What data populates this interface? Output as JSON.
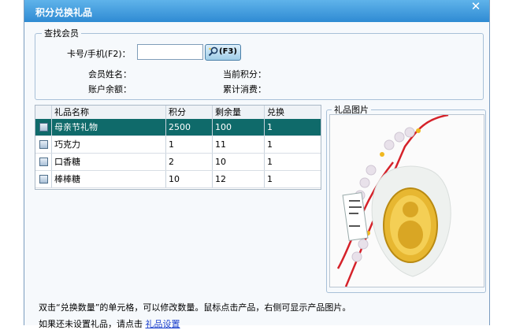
{
  "window": {
    "title": "积分兑换礼品",
    "close_icon": "close-icon"
  },
  "member_search": {
    "legend": "查找会员",
    "card_label": "卡号/手机(F2)：",
    "card_value": "",
    "search_button": "(F3)",
    "name_label": "会员姓名：",
    "points_label": "当前积分：",
    "balance_label": "账户余额：",
    "total_spend_label": "累计消费："
  },
  "gift_table": {
    "columns": [
      "礼品名称",
      "积分",
      "剩余量",
      "兑换"
    ],
    "rows": [
      {
        "name": "母亲节礼物",
        "points": "2500",
        "remaining": "100",
        "exchange": "1",
        "selected": true
      },
      {
        "name": "巧克力",
        "points": "1",
        "remaining": "11",
        "exchange": "1",
        "selected": false
      },
      {
        "name": "口香糖",
        "points": "2",
        "remaining": "10",
        "exchange": "1",
        "selected": false
      },
      {
        "name": "棒棒糖",
        "points": "10",
        "remaining": "12",
        "exchange": "1",
        "selected": false
      }
    ]
  },
  "gift_image": {
    "legend": "礼品图片"
  },
  "footer": {
    "hint": "双击“兑换数量”的单元格，可以修改数量。鼠标点击产品，右侧可显示产品图片。",
    "setup_prefix": "如果还未设置礼品，请点击",
    "setup_link": "礼品设置"
  }
}
